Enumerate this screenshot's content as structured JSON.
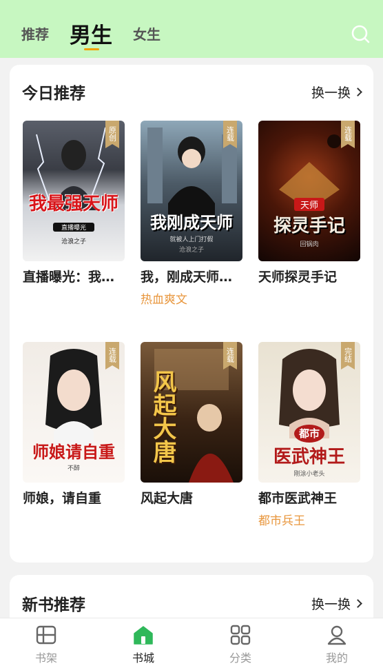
{
  "header": {
    "tabs": [
      {
        "label": "推荐"
      },
      {
        "label": "男生"
      },
      {
        "label": "女生"
      }
    ],
    "active_tab": "男生"
  },
  "today": {
    "title": "今日推荐",
    "refresh": "换一换",
    "books": [
      {
        "name": "直播曝光：我最强天师",
        "tag": "",
        "badge": "原创",
        "cover_title": "我最强天师",
        "cover_sub": "直播曝光",
        "cover_author": "沧浪之子"
      },
      {
        "name": "我，刚成天师就被人上门打假",
        "tag": "热血爽文",
        "badge": "连载",
        "cover_title": "我刚成天师",
        "cover_sub": "就被人上门打假",
        "cover_author": "沧浪之子"
      },
      {
        "name": "天师探灵手记",
        "tag": "",
        "badge": "连载",
        "cover_title": "探灵手记",
        "cover_sub": "天师",
        "cover_author": "回锅肉"
      },
      {
        "name": "师娘，请自重",
        "tag": "",
        "badge": "连载",
        "cover_title": "师娘请自重",
        "cover_sub": "",
        "cover_author": "不醉"
      },
      {
        "name": "风起大唐",
        "tag": "",
        "badge": "连载",
        "cover_title": "风起大唐",
        "cover_sub": "",
        "cover_author": ""
      },
      {
        "name": "都市医武神王",
        "tag": "都市兵王",
        "badge": "完结",
        "cover_title": "医武神王",
        "cover_sub": "都市",
        "cover_author": "刚涂小老头"
      }
    ]
  },
  "newbooks": {
    "title": "新书推荐",
    "refresh": "换一换"
  },
  "nav": [
    {
      "label": "书架",
      "icon": "bookshelf-icon"
    },
    {
      "label": "书城",
      "icon": "store-icon"
    },
    {
      "label": "分类",
      "icon": "category-icon"
    },
    {
      "label": "我的",
      "icon": "profile-icon"
    }
  ],
  "colors": {
    "header_bg": "#c7f7c1",
    "accent": "#2fb85a",
    "tag": "#e8963c",
    "badge": "#c9a86e",
    "underline": "#f2a100"
  }
}
